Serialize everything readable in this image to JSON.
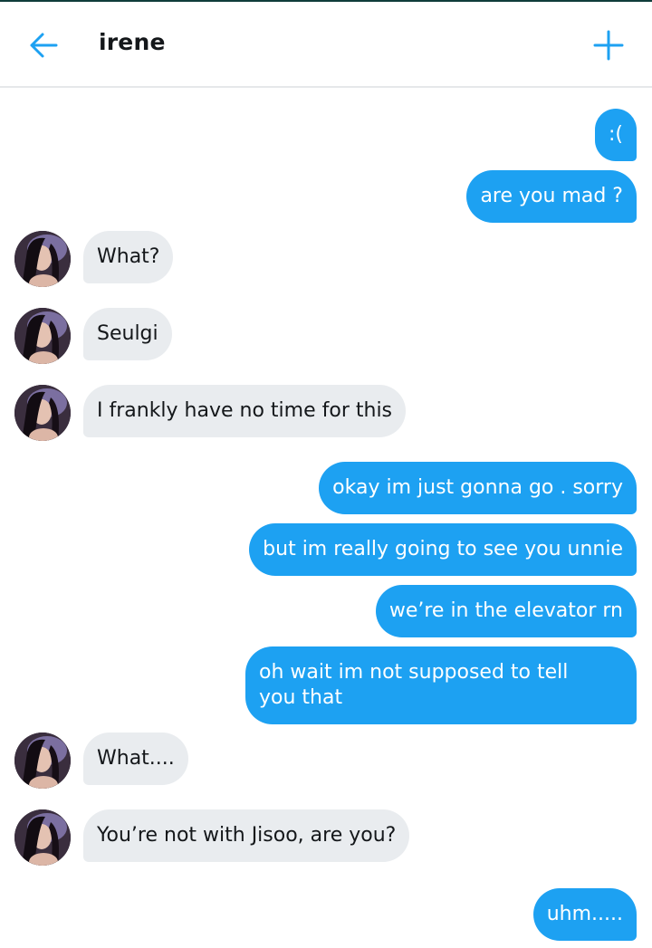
{
  "header": {
    "title": "irene",
    "back_icon": "arrow-left-icon",
    "add_icon": "plus-icon",
    "accent_color": "#1da1f2"
  },
  "colors": {
    "sent_bubble": "#1da1f2",
    "received_bubble": "#e9ecef",
    "text_dark": "#14171a"
  },
  "messages": [
    {
      "from": "me",
      "text": ":("
    },
    {
      "from": "me",
      "text": "are you mad ?"
    },
    {
      "from": "irene",
      "text": "What?"
    },
    {
      "from": "irene",
      "text": "Seulgi"
    },
    {
      "from": "irene",
      "text": "I frankly have no time for this"
    },
    {
      "from": "me",
      "text": "okay im just gonna go . sorry"
    },
    {
      "from": "me",
      "text": "but im really going to see you unnie"
    },
    {
      "from": "me",
      "text": "we’re in the elevator rn"
    },
    {
      "from": "me",
      "text": "oh wait im not supposed to tell\nyou that"
    },
    {
      "from": "irene",
      "text": "What...."
    },
    {
      "from": "irene",
      "text": "You’re not with Jisoo, are you?"
    },
    {
      "from": "me",
      "text": "uhm....."
    }
  ]
}
